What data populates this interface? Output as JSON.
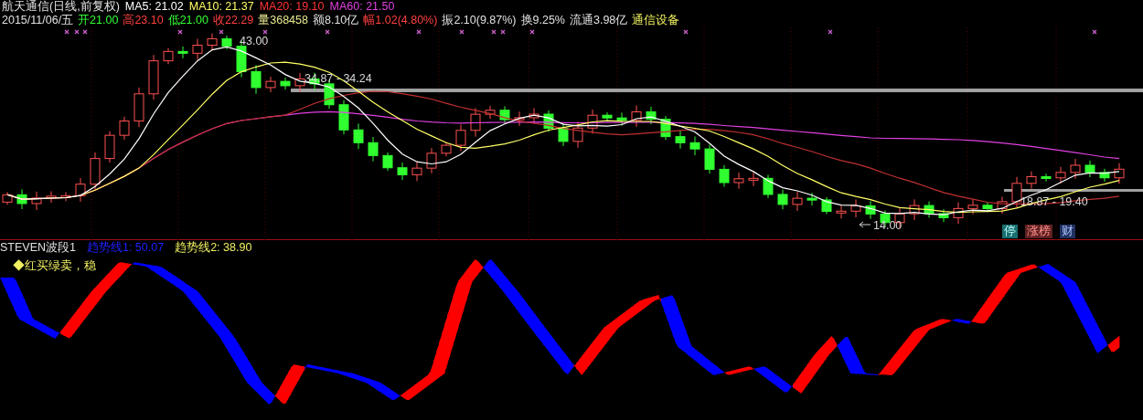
{
  "header": {
    "title": "航天通信(日线,前复权)",
    "ma": [
      {
        "text": "MA5: 21.02",
        "color": "#ffffff"
      },
      {
        "text": "MA10: 21.37",
        "color": "#ffff66"
      },
      {
        "text": "MA20: 19.10",
        "color": "#ff3333"
      },
      {
        "text": "MA60: 21.50",
        "color": "#e040e0"
      }
    ]
  },
  "quote": [
    {
      "text": "2015/11/06/五",
      "color": "#e0e0e0"
    },
    {
      "text": "开21.00",
      "color": "#33ff33"
    },
    {
      "text": "高23.10",
      "color": "#ff4040"
    },
    {
      "text": "低21.00",
      "color": "#33ff33"
    },
    {
      "text": "收22.29",
      "color": "#ff4040"
    },
    {
      "text": "量368458",
      "color": "#e8e890"
    },
    {
      "text": "额8.10亿",
      "color": "#e0e0e0"
    },
    {
      "text": "幅1.02(4.80%)",
      "color": "#ff4040"
    },
    {
      "text": "振2.10(9.87%)",
      "color": "#e0e0e0"
    },
    {
      "text": "换9.25%",
      "color": "#e0e0e0"
    },
    {
      "text": "流通3.98亿",
      "color": "#e0e0e0"
    },
    {
      "text": "通信设备",
      "color": "#f0f060"
    }
  ],
  "main_chart": {
    "annotations": [
      {
        "kind": "high",
        "text": "43.00"
      },
      {
        "kind": "range",
        "text": "34.87 - 34.24"
      },
      {
        "kind": "range2",
        "text": "18.87 - 19.40"
      },
      {
        "kind": "low",
        "text": "14.00"
      }
    ],
    "badges": [
      {
        "text": "停",
        "color": "#1a7070"
      },
      {
        "text": "涨榜",
        "color": "#602020"
      },
      {
        "text": "财",
        "color": "#203060"
      }
    ]
  },
  "indicator": {
    "name": "STEVEN波段1",
    "lines": [
      {
        "text": "趋势线1: 50.07",
        "color": "#2020ff"
      },
      {
        "text": "趋势线2: 38.90",
        "color": "#f0f060"
      }
    ],
    "note": "◆红买绿卖，稳"
  }
}
